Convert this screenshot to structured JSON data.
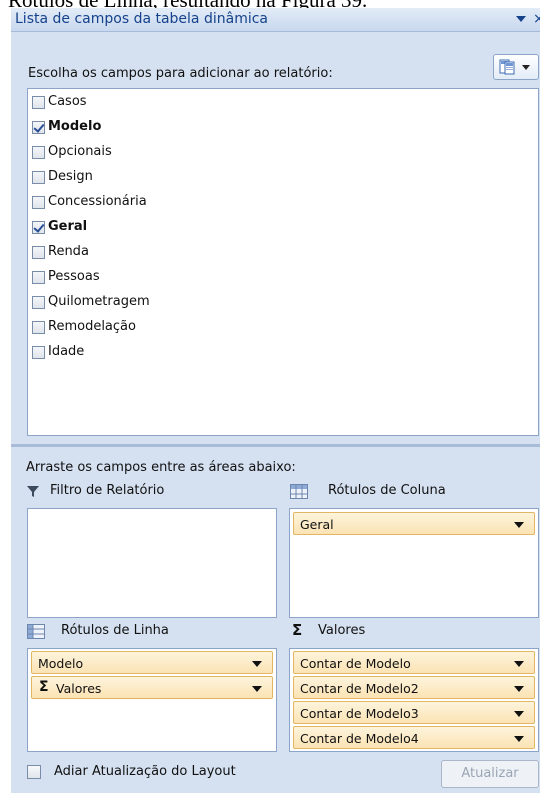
{
  "document": {
    "background_text": "Rótulos de Linha, resultando na Figura 39."
  },
  "panel": {
    "title": "Lista de campos da tabela dinâmica",
    "close_glyph": "×"
  },
  "fields": {
    "instruction": "Escolha os campos para adicionar ao relatório:",
    "items": [
      {
        "label": "Casos",
        "checked": false
      },
      {
        "label": "Modelo",
        "checked": true
      },
      {
        "label": "Opcionais",
        "checked": false
      },
      {
        "label": "Design",
        "checked": false
      },
      {
        "label": "Concessionária",
        "checked": false
      },
      {
        "label": "Geral",
        "checked": true
      },
      {
        "label": "Renda",
        "checked": false
      },
      {
        "label": "Pessoas",
        "checked": false
      },
      {
        "label": "Quilometragem",
        "checked": false
      },
      {
        "label": "Remodelação",
        "checked": false
      },
      {
        "label": "Idade",
        "checked": false
      }
    ]
  },
  "areas": {
    "instruction": "Arraste os campos entre as áreas abaixo:",
    "report_filter": {
      "label": "Filtro de Relatório",
      "icon": "filter-icon",
      "items": []
    },
    "column_labels": {
      "label": "Rótulos de Coluna",
      "icon": "grid-icon",
      "items": [
        "Geral"
      ]
    },
    "row_labels": {
      "label": "Rótulos de Linha",
      "icon": "grid-icon",
      "items": [
        {
          "label": "Modelo",
          "sigma": false
        },
        {
          "label": "Valores",
          "sigma": true,
          "sigma_glyph": "Σ"
        }
      ]
    },
    "values": {
      "label": "Valores",
      "icon": "sigma-icon",
      "icon_glyph": "Σ",
      "items": [
        "Contar de Modelo",
        "Contar de Modelo2",
        "Contar de Modelo3",
        "Contar de Modelo4"
      ]
    }
  },
  "footer": {
    "defer_label": "Adiar Atualização do Layout",
    "defer_checked": false,
    "update_label": "Atualizar",
    "update_enabled": false
  },
  "colors": {
    "panel_bg": "#d5e1f1",
    "title_text": "#15428b",
    "chip_fill": "#fbe3b4",
    "chip_border": "#e2b662",
    "check_mark": "#2a4e96"
  }
}
